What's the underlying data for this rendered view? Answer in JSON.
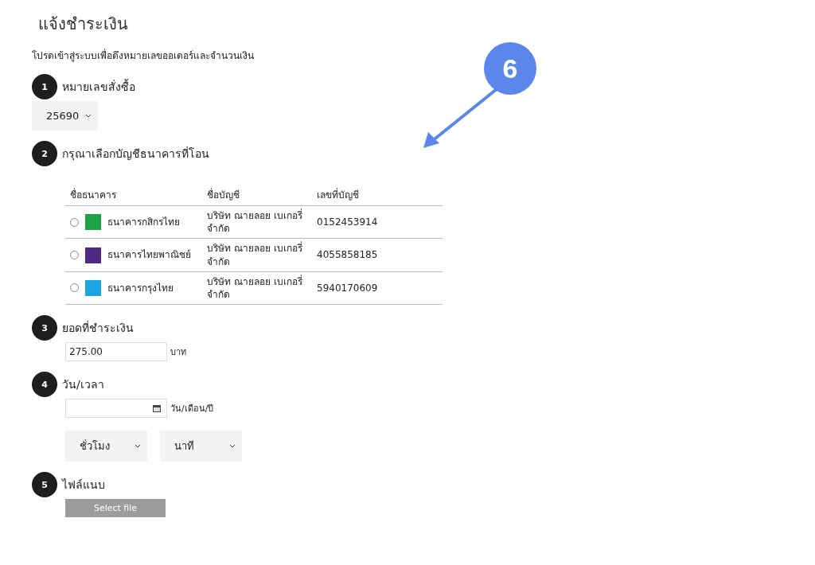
{
  "title": "แจ้งชำระเงิน",
  "subtitle": "โปรดเข้าสู่ระบบเพื่อดึงหมายเลขออเดอร์และจำนวนเงิน",
  "steps": [
    {
      "number": "1",
      "label": "หมายเลขสั่งซื้อ",
      "kind": "order"
    },
    {
      "number": "2",
      "label": "กรุณาเลือกบัญชีธนาคารที่โอน",
      "kind": "bank"
    },
    {
      "number": "3",
      "label": "ยอดที่ชำระเงิน",
      "kind": "amount"
    },
    {
      "number": "4",
      "label": "วัน/เวลา",
      "kind": "datetime"
    },
    {
      "number": "5",
      "label": "ไฟล์แนบ",
      "kind": "file"
    }
  ],
  "order_select": {
    "value": "25690"
  },
  "bank_table": {
    "columns": [
      "ชื่อธนาคาร",
      "ชื่อบัญชี",
      "เลขที่บัญชี"
    ],
    "rows": [
      {
        "selected": false,
        "color": "#1ba345",
        "bank": "ธนาคารกสิกรไทย",
        "account_name": "บริษัท ณายลอย เบเกอรี่ จำกัด",
        "account_number": "0152453914"
      },
      {
        "selected": false,
        "color": "#4e2a84",
        "bank": "ธนาคารไทยพาณิชย์",
        "account_name": "บริษัท ณายลอย เบเกอรี่ จำกัด",
        "account_number": "4055858185"
      },
      {
        "selected": false,
        "color": "#1ba5e1",
        "bank": "ธนาคารกรุงไทย",
        "account_name": "บริษัท ณายลอย เบเกอรี่ จำกัด",
        "account_number": "5940170609"
      }
    ]
  },
  "amount": {
    "value": "275.00",
    "unit": "บาท"
  },
  "date": {
    "hint": "วัน/เดือน/ปี"
  },
  "time_selects": [
    {
      "value": "ชั่วโมง"
    },
    {
      "value": "นาที"
    }
  ],
  "file_button": "Select file",
  "annotation": {
    "number": "6"
  }
}
